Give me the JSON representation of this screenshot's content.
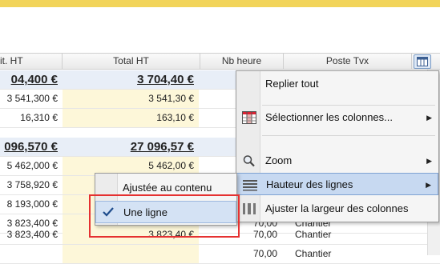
{
  "header": {
    "columns": [
      "it. HT",
      "Total HT",
      "Nb heure",
      "Poste Tvx"
    ],
    "icon": "column-chooser-icon"
  },
  "rows": [
    {
      "type": "group",
      "unit": "04,400 €",
      "total": "3 704,40 €",
      "hours": "",
      "poste": ""
    },
    {
      "type": "row",
      "unit": "3 541,300 €",
      "total": "3 541,30 €",
      "hours": "",
      "poste": ""
    },
    {
      "type": "row",
      "unit": "16,310 €",
      "total": "163,10 €",
      "hours": "",
      "poste": ""
    },
    {
      "type": "group",
      "unit": "096,570 €",
      "total": "27 096,57 €",
      "hours": "",
      "poste": ""
    },
    {
      "type": "row",
      "unit": "5 462,000 €",
      "total": "5 462,00 €",
      "hours": "",
      "poste": ""
    },
    {
      "type": "row",
      "unit": "3 758,920 €",
      "total": "",
      "hours": "",
      "poste": ""
    },
    {
      "type": "row",
      "unit": "8 193,000 €",
      "total": "",
      "hours": "",
      "poste": ""
    },
    {
      "type": "row",
      "unit": "3 823,400 €",
      "total": "",
      "hours": "70,00",
      "poste": "Chantier"
    },
    {
      "type": "row",
      "unit": "3 823,400 €",
      "total": "3 823,40 €",
      "hours": "70,00",
      "poste": "Chantier"
    },
    {
      "type": "row",
      "unit": "",
      "total": "",
      "hours": "70,00",
      "poste": "Chantier"
    }
  ],
  "menu": {
    "items": [
      {
        "label": "Replier tout",
        "icon": "",
        "submenu": false
      },
      {
        "label": "Sélectionner les colonnes...",
        "icon": "columns-grid-icon",
        "submenu": true
      },
      {
        "label": "Zoom",
        "icon": "magnifier-icon",
        "submenu": true
      },
      {
        "label": "Hauteur des lignes",
        "icon": "row-height-icon",
        "submenu": true
      },
      {
        "label": "Ajuster la largeur des colonnes",
        "icon": "column-width-icon",
        "submenu": false
      }
    ]
  },
  "submenu": {
    "items": [
      {
        "label": "Ajustée au contenu",
        "checked": false
      },
      {
        "label": "Une ligne",
        "checked": true
      }
    ]
  },
  "colors": {
    "accent_yellow": "#f2d45a",
    "highlight": "#c7d9f1",
    "annotation_red": "#e53131"
  }
}
